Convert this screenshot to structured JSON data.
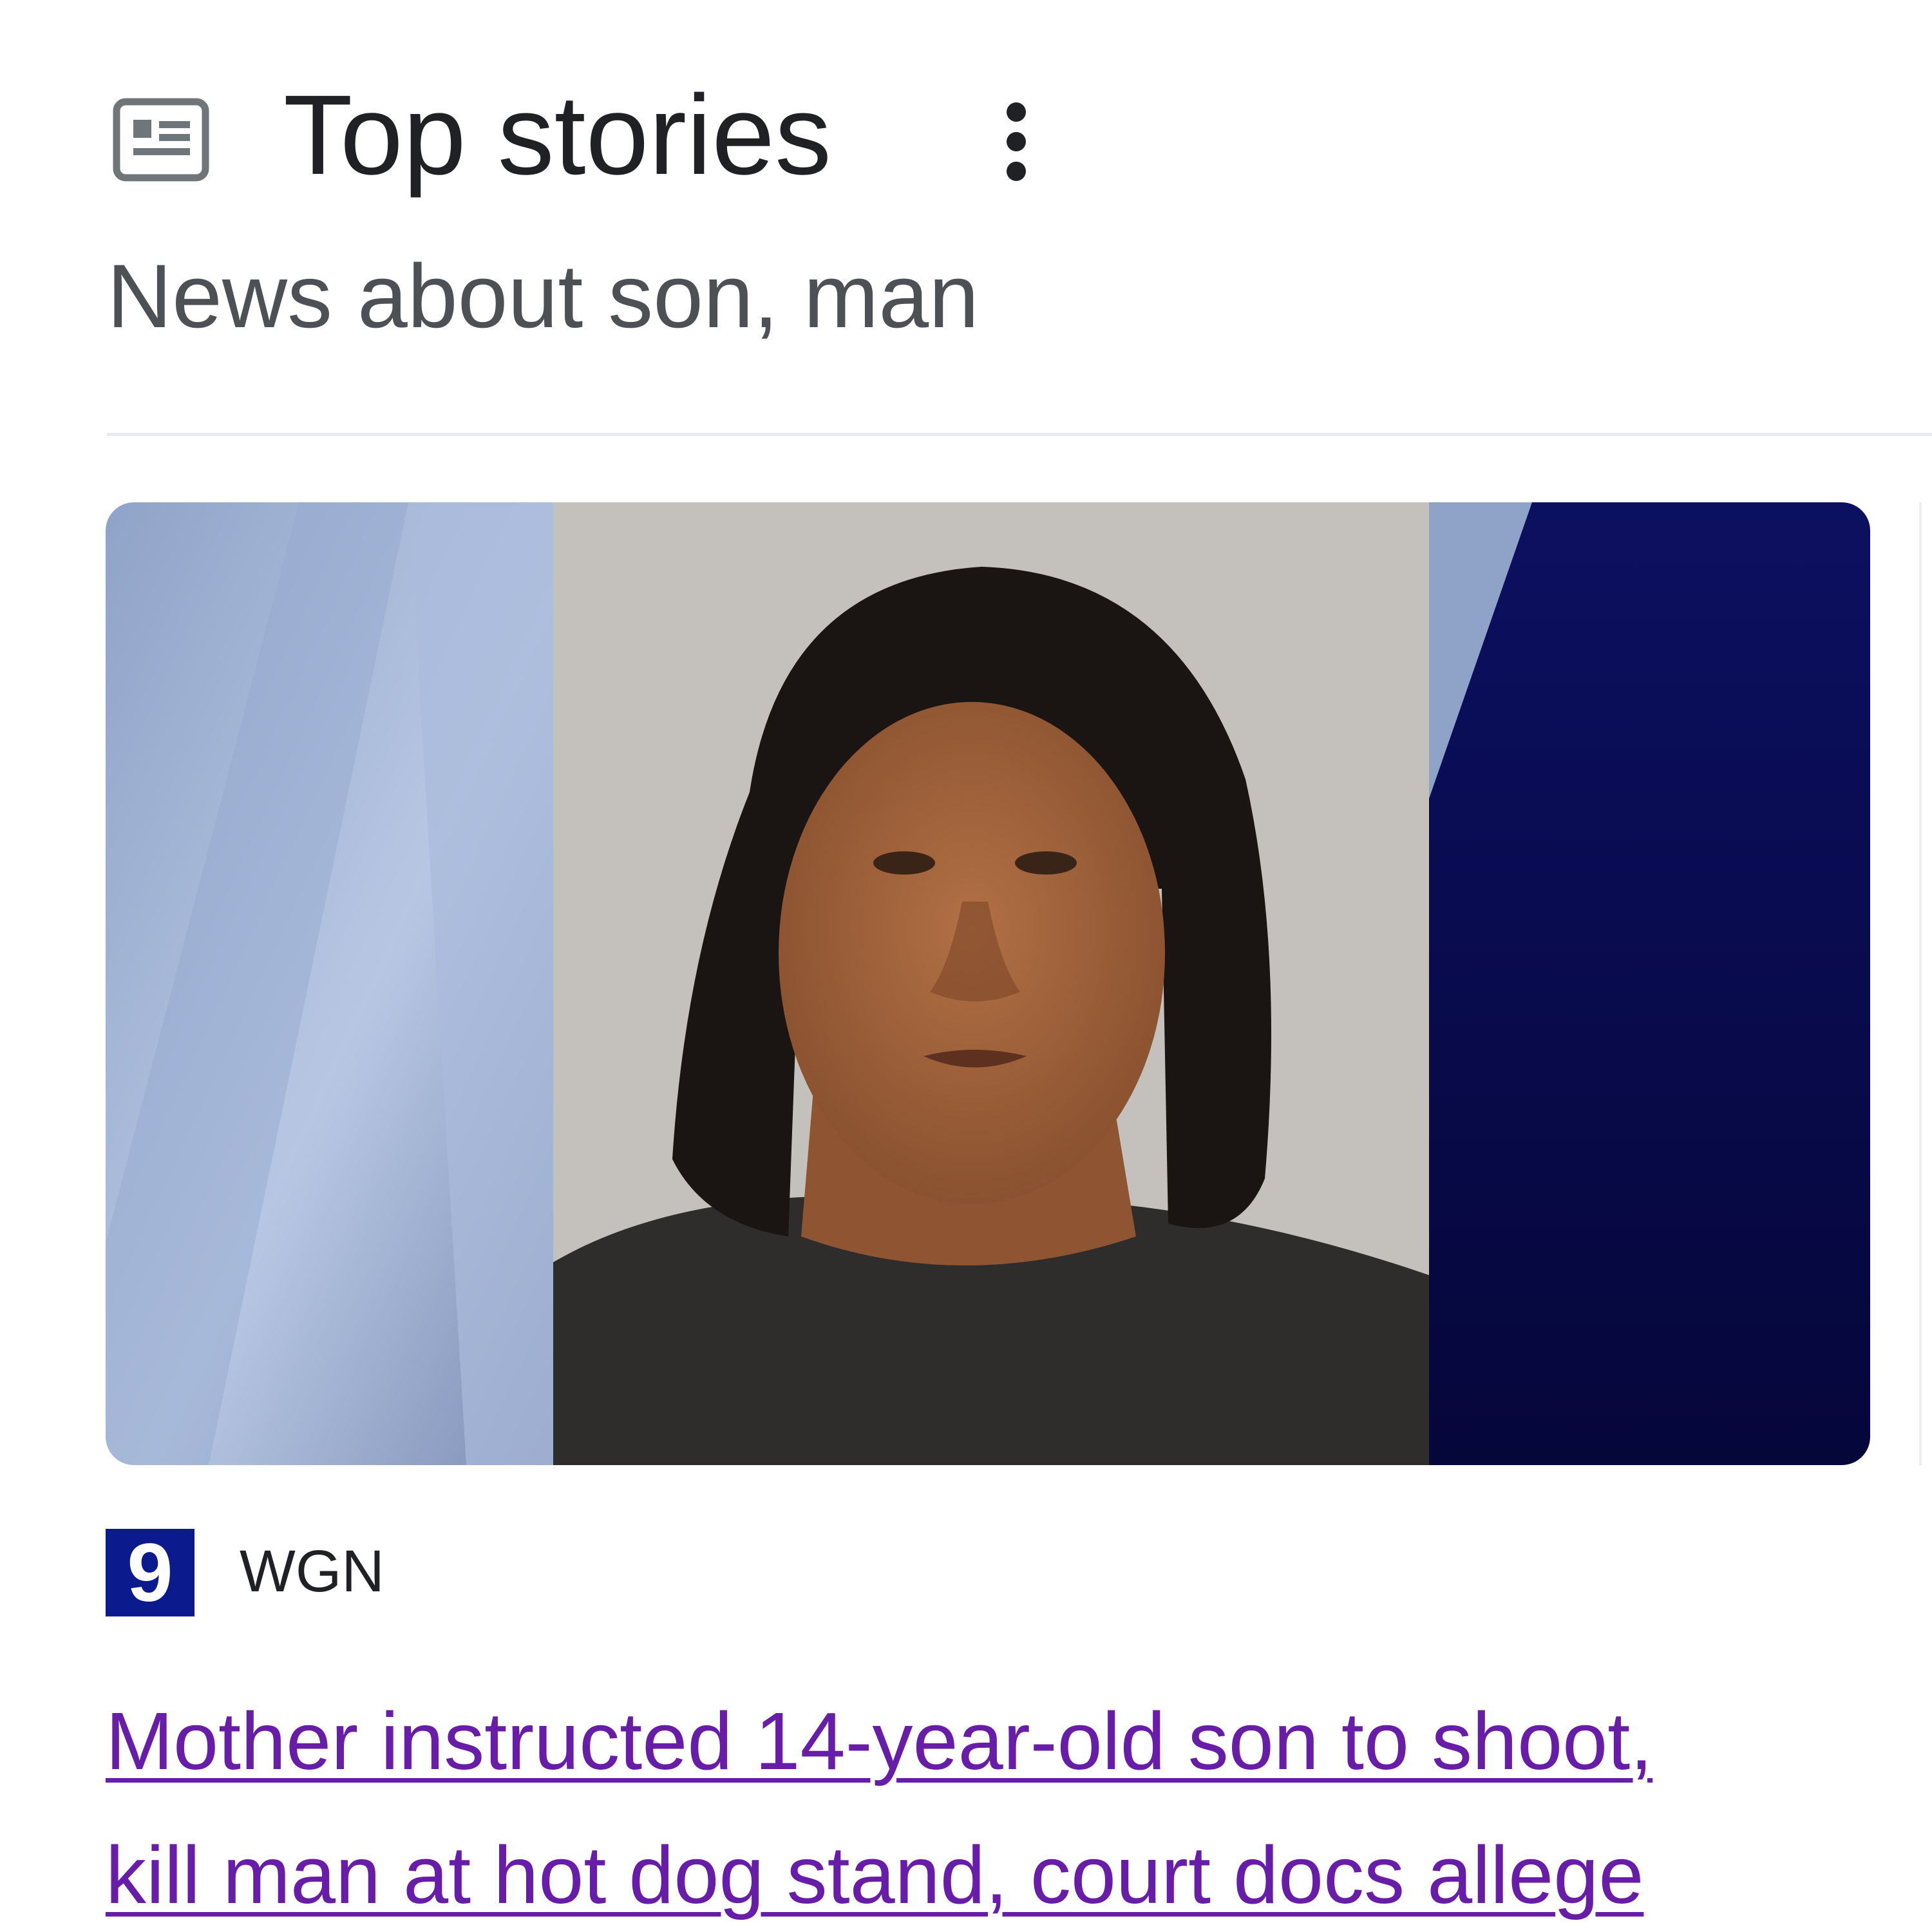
{
  "header": {
    "title": "Top stories",
    "subtitle": "News about son, man",
    "icon": "newspaper-icon",
    "menu_icon": "more-vert-icon"
  },
  "story": {
    "source": "WGN",
    "source_logo_text": "9",
    "source_logo_color": "#0b1a8c",
    "headline_lines": [
      "Mother instructed 14-year-old son to shoot,",
      "kill man at hot dog stand, court docs allege"
    ],
    "headline_color": "#681da8"
  },
  "colors": {
    "title": "#202124",
    "subtitle": "#4d5156",
    "divider": "#e8eaed",
    "image_left_panel": "#9fb3d6",
    "image_right_panel": "#0a0c55",
    "image_backdrop": "#c4c1bc"
  }
}
